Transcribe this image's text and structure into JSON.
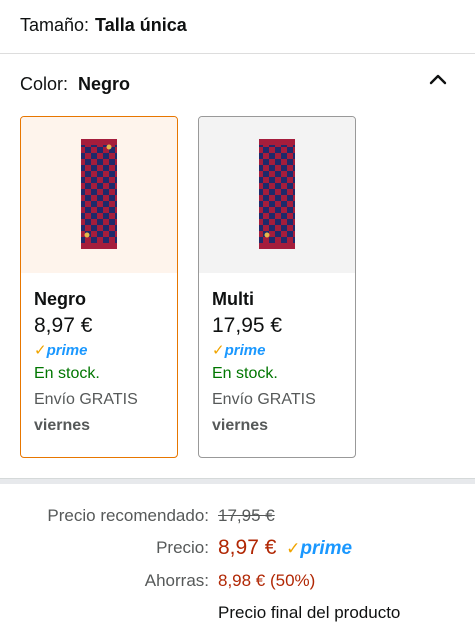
{
  "size": {
    "label": "Tamaño:",
    "value": "Talla única"
  },
  "color": {
    "label": "Color:",
    "value": "Negro",
    "expanded_icon": "chevron-up-icon"
  },
  "swatches": [
    {
      "name": "Negro",
      "price": "8,97 €",
      "prime_check": "✓",
      "prime_word": "prime",
      "stock": "En stock.",
      "shipping": "Envío GRATIS",
      "day": "viernes",
      "selected": true
    },
    {
      "name": "Multi",
      "price": "17,95 €",
      "prime_check": "✓",
      "prime_word": "prime",
      "stock": "En stock.",
      "shipping": "Envío GRATIS",
      "day": "viernes",
      "selected": false
    }
  ],
  "pricing": {
    "recommended_label": "Precio recomendado:",
    "recommended_value": "17,95 €",
    "price_label": "Precio:",
    "price_value": "8,97 €",
    "prime_check": "✓",
    "prime_word": "prime",
    "savings_label": "Ahorras:",
    "savings_value": "8,98 € (50%)",
    "final_note": "Precio final del producto"
  },
  "colors": {
    "selected_border": "#e77600",
    "selected_bg": "#fef4ec",
    "stock_green": "#007600",
    "price_red": "#b12704",
    "prime_blue": "#1a98ff",
    "prime_check": "#f0a400",
    "product_red": "#a51d3c",
    "product_navy": "#1f2a6b"
  }
}
